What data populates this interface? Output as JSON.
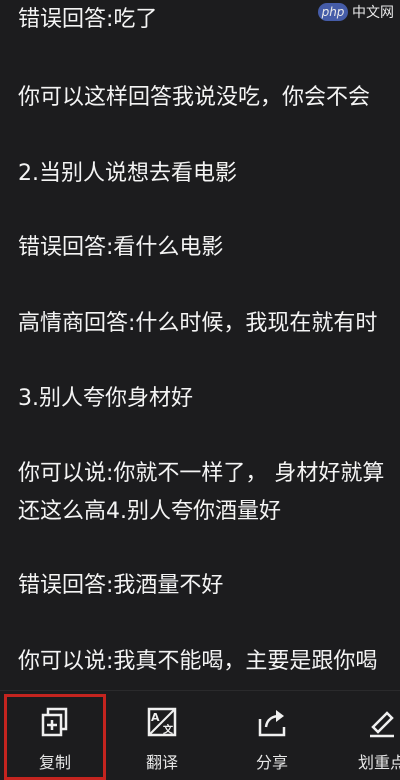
{
  "watermark": {
    "logo": "php",
    "text": "中文网"
  },
  "lines": [
    "错误回答:吃了",
    "你可以这样回答我说没吃，你会不会",
    "2.当别人说想去看电影",
    "错误回答:看什么电影",
    "高情商回答:什么时候，我现在就有时",
    "3.别人夸你身材好",
    "你可以说:你就不一样了， 身材好就算",
    "还这么高4.别人夸你酒量好",
    "错误回答:我酒量不好",
    "你可以说:我真不能喝，主要是跟你喝"
  ],
  "toolbar": {
    "copy": "复制",
    "translate": "翻译",
    "share": "分享",
    "highlight": "划重点"
  },
  "colors": {
    "background": "#1c1c1e",
    "highlight_border": "#c4241f"
  }
}
